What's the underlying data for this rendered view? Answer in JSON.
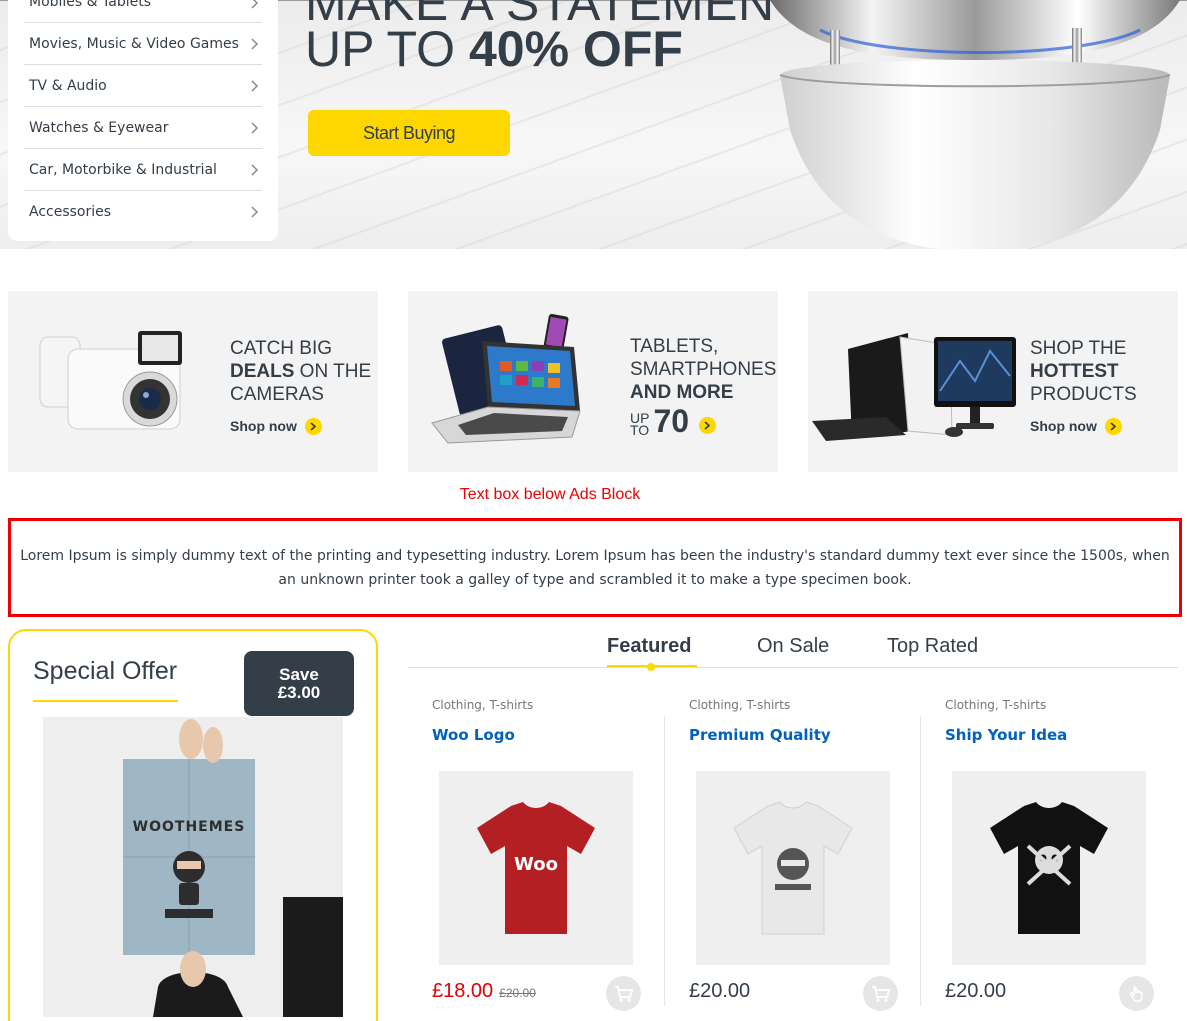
{
  "hero": {
    "headline_top": "MAKE A STATEMENT",
    "headline_light": "UP TO ",
    "headline_bold": "40% OFF",
    "cta": "Start Buying"
  },
  "categories": [
    {
      "label": "Mobiles & Tablets"
    },
    {
      "label": "Movies, Music & Video Games"
    },
    {
      "label": "TV & Audio"
    },
    {
      "label": "Watches & Eyewear"
    },
    {
      "label": "Car, Motorbike & Industrial"
    },
    {
      "label": "Accessories"
    }
  ],
  "ads": [
    {
      "line1": "CATCH BIG",
      "bold": "DEALS",
      "line2_rest": " ON THE",
      "line3": "CAMERAS",
      "cta": "Shop now"
    },
    {
      "line1": "TABLETS,",
      "line2": "SMARTPHONES",
      "bold": "AND MORE",
      "upto_small1": "UP",
      "upto_small2": "TO",
      "upto_big": "70"
    },
    {
      "line1": "SHOP THE",
      "bold": "HOTTEST",
      "line3": "PRODUCTS",
      "cta": "Shop now"
    }
  ],
  "textbox": {
    "caption": "Text box below Ads Block",
    "body": "Lorem Ipsum is simply dummy text of the printing and typesetting industry. Lorem Ipsum has been the industry's standard dummy text ever since the 1500s, when an unknown printer took a galley of type and scrambled it to make a type specimen book."
  },
  "special_offer": {
    "title": "Special Offer",
    "save_label": "Save",
    "save_amount": "£3.00",
    "poster_brand": "WOOTHEMES"
  },
  "tabs": [
    {
      "label": "Featured",
      "active": true
    },
    {
      "label": "On Sale",
      "active": false
    },
    {
      "label": "Top Rated",
      "active": false
    }
  ],
  "products": [
    {
      "category": "Clothing, T-shirts",
      "name": "Woo Logo",
      "price": "£18.00",
      "old_price": "£20.00",
      "shirt_color": "#b31f22",
      "shirt_text": "Woo"
    },
    {
      "category": "Clothing, T-shirts",
      "name": "Premium Quality",
      "price": "£20.00",
      "old_price": "",
      "shirt_color": "#e8e8e8"
    },
    {
      "category": "Clothing, T-shirts",
      "name": "Ship Your Idea",
      "price": "£20.00",
      "old_price": "",
      "shirt_color": "#111111"
    }
  ],
  "colors": {
    "accent": "#fed700",
    "text": "#333e48",
    "link": "#0062bd",
    "sale": "#e00000",
    "highlight_box": "#ee0000"
  }
}
